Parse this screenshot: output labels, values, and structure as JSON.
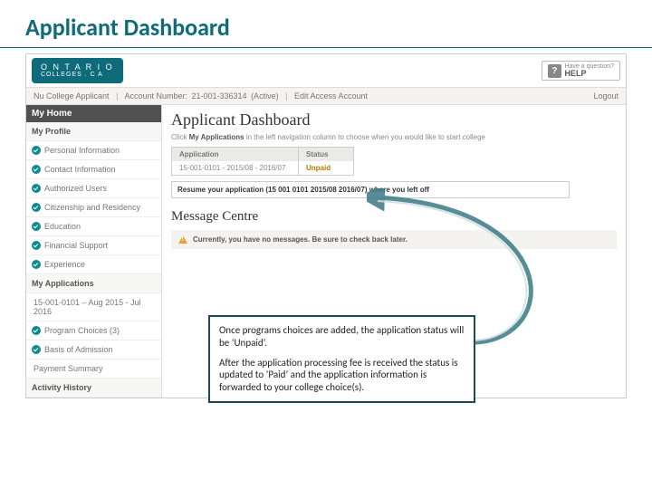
{
  "slide_title": "Applicant Dashboard",
  "logo": {
    "line1": "O N T A R I O",
    "line2": "COLLEGES . C A"
  },
  "help": {
    "small": "Have a question?",
    "big": "HELP"
  },
  "topbar": {
    "user": "Nu College Applicant",
    "account_label": "Account Number:",
    "account_number": "21-001-336314",
    "account_status": "(Active)",
    "edit": "Edit Access Account",
    "logout": "Logout"
  },
  "sidebar": {
    "home": "My Home",
    "profile": "My Profile",
    "items": [
      "Personal Information",
      "Contact Information",
      "Authorized Users",
      "Citizenship and Residency",
      "Education",
      "Financial Support",
      "Experience"
    ],
    "apps": "My Applications",
    "app_item": "15-001-0101 – Aug 2015 - Jul 2016",
    "sub": [
      "Program Choices (3)",
      "Basis of Admission",
      "Payment Summary"
    ],
    "history": "Activity History"
  },
  "main": {
    "heading": "Applicant Dashboard",
    "instr_pre": "Click ",
    "instr_bold": "My Applications",
    "instr_post": " in the left navigation column to choose when you would like to start college",
    "col_app": "Application",
    "col_status": "Status",
    "row_app": "15-001-0101 - 2015/08 - 2016/07",
    "row_status": "Unpaid",
    "resume_pre": "Resume your application (",
    "resume_id": "15 001 0101   2015/08   2016/07",
    "resume_post": ") where you left off",
    "msg_title": "Message Centre",
    "msg_text": "Currently, you have no messages. Be sure to check back later."
  },
  "callout": {
    "p1": "Once programs choices are added, the application status will be ‘Unpaid’.",
    "p2": "After the application processing fee is received the status is updated to ‘Paid’ and the application information is forwarded to your college choice(s)."
  }
}
